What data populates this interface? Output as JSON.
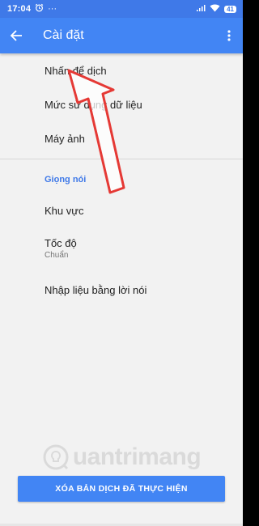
{
  "status_bar": {
    "time": "17:04",
    "battery": "41"
  },
  "appbar": {
    "title": "Cài đặt"
  },
  "settings": {
    "items": [
      {
        "label": "Nhấn để dịch"
      },
      {
        "label": "Mức sử dụng dữ liệu"
      },
      {
        "label": "Máy ảnh"
      }
    ],
    "voice_section": {
      "header": "Giọng nói",
      "items": [
        {
          "label": "Khu vực"
        },
        {
          "label": "Tốc độ",
          "summary": "Chuẩn"
        },
        {
          "label": "Nhập liệu bằng lời nói"
        }
      ]
    }
  },
  "clear_button": {
    "label": "XÓA BẢN DỊCH ĐÃ THỰC HIỆN"
  },
  "watermark": {
    "text": "uantrimang"
  },
  "colors": {
    "status_bar": "#3f79e8",
    "appbar": "#4285f4",
    "accent": "#3f79e8",
    "arrow": "#e53935"
  }
}
